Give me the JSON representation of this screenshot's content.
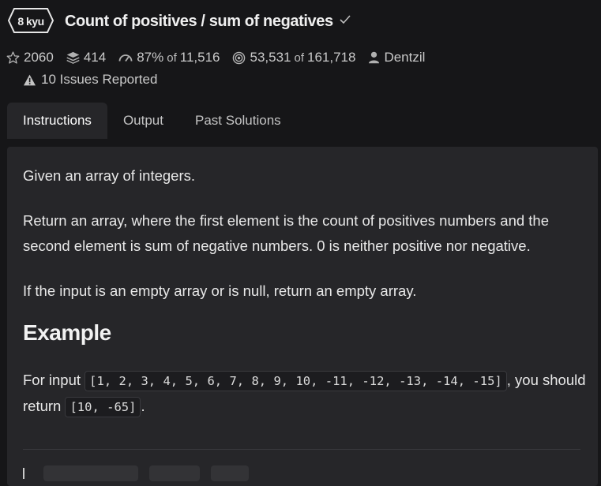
{
  "kata": {
    "rank": "8 kyu",
    "title": "Count of positives / sum of negatives"
  },
  "stats": {
    "stars": "2060",
    "collections": "414",
    "satisfaction_pct": "87%",
    "satisfaction_of": "of",
    "satisfaction_votes": "11,516",
    "completed": "53,531",
    "completed_of": "of",
    "attempted": "161,718",
    "author": "Dentzil",
    "issues": "10 Issues Reported"
  },
  "tabs": [
    {
      "label": "Instructions"
    },
    {
      "label": "Output"
    },
    {
      "label": "Past Solutions"
    }
  ],
  "description": {
    "p1": "Given an array of integers.",
    "p2": "Return an array, where the first element is the count of positives numbers and the second element is sum of negative numbers. 0 is neither positive nor negative.",
    "p3": "If the input is an empty array or is null, return an empty array.",
    "example_heading": "Example",
    "p4_prefix": "For input ",
    "p4_input_code": "[1, 2, 3, 4, 5, 6, 7, 8, 9, 10, -11, -12, -13, -14, -15]",
    "p4_middle": ", you should return ",
    "p4_output_code": "[10, -65]",
    "p4_suffix": "."
  },
  "icons": {
    "star": "star-outline-icon",
    "collection": "stack-icon",
    "satisfaction": "gauge-icon",
    "completed": "target-icon",
    "author": "user-icon",
    "issues": "warning-icon",
    "title_check": "check-icon"
  }
}
